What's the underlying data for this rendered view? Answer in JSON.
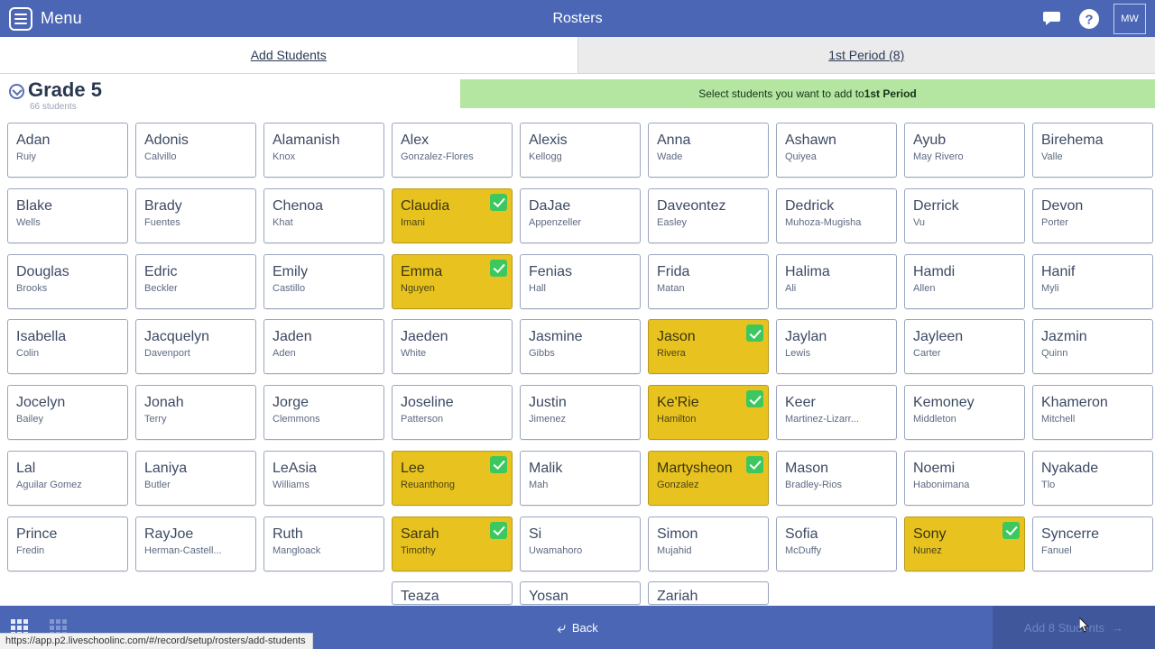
{
  "appbar": {
    "menu_label": "Menu",
    "title": "Rosters",
    "chat_icon": "chat-bubble-icon",
    "help_icon": "question-mark-icon",
    "avatar_initials": "MW"
  },
  "tabs": [
    {
      "label": "Add Students",
      "active": true
    },
    {
      "label": "1st Period (8)",
      "active": false
    }
  ],
  "grade": {
    "name": "Grade 5",
    "count": "66 students",
    "chevron_icon": "chevron-down-circle-icon"
  },
  "banner": {
    "prefix": "Select students you want to add to ",
    "emphasis": "1st Period",
    "color": "#b5e6a1"
  },
  "colors": {
    "brand": "#4a66b5",
    "selected_card": "#e8c320",
    "check_badge": "#3cc85f",
    "banner": "#b5e6a1"
  },
  "students": [
    {
      "first": "Adan",
      "last": "Ruiy",
      "selected": false
    },
    {
      "first": "Adonis",
      "last": "Calvillo",
      "selected": false
    },
    {
      "first": "Alamanish",
      "last": "Knox",
      "selected": false
    },
    {
      "first": "Alex",
      "last": "Gonzalez-Flores",
      "selected": false
    },
    {
      "first": "Alexis",
      "last": "Kellogg",
      "selected": false
    },
    {
      "first": "Anna",
      "last": "Wade",
      "selected": false
    },
    {
      "first": "Ashawn",
      "last": "Quiyea",
      "selected": false
    },
    {
      "first": "Ayub",
      "last": "May Rivero",
      "selected": false
    },
    {
      "first": "Birehema",
      "last": "Valle",
      "selected": false
    },
    {
      "first": "Blake",
      "last": "Wells",
      "selected": false
    },
    {
      "first": "Brady",
      "last": "Fuentes",
      "selected": false
    },
    {
      "first": "Chenoa",
      "last": "Khat",
      "selected": false
    },
    {
      "first": "Claudia",
      "last": "Imani",
      "selected": true
    },
    {
      "first": "DaJae",
      "last": "Appenzeller",
      "selected": false
    },
    {
      "first": "Daveontez",
      "last": "Easley",
      "selected": false
    },
    {
      "first": "Dedrick",
      "last": "Muhoza-Mugisha",
      "selected": false
    },
    {
      "first": "Derrick",
      "last": "Vu",
      "selected": false
    },
    {
      "first": "Devon",
      "last": "Porter",
      "selected": false
    },
    {
      "first": "Douglas",
      "last": "Brooks",
      "selected": false
    },
    {
      "first": "Edric",
      "last": "Beckler",
      "selected": false
    },
    {
      "first": "Emily",
      "last": "Castillo",
      "selected": false
    },
    {
      "first": "Emma",
      "last": "Nguyen",
      "selected": true
    },
    {
      "first": "Fenias",
      "last": "Hall",
      "selected": false
    },
    {
      "first": "Frida",
      "last": "Matan",
      "selected": false
    },
    {
      "first": "Halima",
      "last": "Ali",
      "selected": false
    },
    {
      "first": "Hamdi",
      "last": "Allen",
      "selected": false
    },
    {
      "first": "Hanif",
      "last": "Myli",
      "selected": false
    },
    {
      "first": "Isabella",
      "last": "Colin",
      "selected": false
    },
    {
      "first": "Jacquelyn",
      "last": "Davenport",
      "selected": false
    },
    {
      "first": "Jaden",
      "last": "Aden",
      "selected": false
    },
    {
      "first": "Jaeden",
      "last": "White",
      "selected": false
    },
    {
      "first": "Jasmine",
      "last": "Gibbs",
      "selected": false
    },
    {
      "first": "Jason",
      "last": "Rivera",
      "selected": true
    },
    {
      "first": "Jaylan",
      "last": "Lewis",
      "selected": false
    },
    {
      "first": "Jayleen",
      "last": "Carter",
      "selected": false
    },
    {
      "first": "Jazmin",
      "last": "Quinn",
      "selected": false
    },
    {
      "first": "Jocelyn",
      "last": "Bailey",
      "selected": false
    },
    {
      "first": "Jonah",
      "last": "Terry",
      "selected": false
    },
    {
      "first": "Jorge",
      "last": "Clemmons",
      "selected": false
    },
    {
      "first": "Joseline",
      "last": "Patterson",
      "selected": false
    },
    {
      "first": "Justin",
      "last": "Jimenez",
      "selected": false
    },
    {
      "first": "Ke'Rie",
      "last": "Hamilton",
      "selected": true
    },
    {
      "first": "Keer",
      "last": "Martinez-Lizarr...",
      "selected": false
    },
    {
      "first": "Kemoney",
      "last": "Middleton",
      "selected": false
    },
    {
      "first": "Khameron",
      "last": "Mitchell",
      "selected": false
    },
    {
      "first": "Lal",
      "last": "Aguilar Gomez",
      "selected": false
    },
    {
      "first": "Laniya",
      "last": "Butler",
      "selected": false
    },
    {
      "first": "LeAsia",
      "last": "Williams",
      "selected": false
    },
    {
      "first": "Lee",
      "last": "Reuanthong",
      "selected": true
    },
    {
      "first": "Malik",
      "last": "Mah",
      "selected": false
    },
    {
      "first": "Martysheon",
      "last": "Gonzalez",
      "selected": true
    },
    {
      "first": "Mason",
      "last": "Bradley-Rios",
      "selected": false
    },
    {
      "first": "Noemi",
      "last": "Habonimana",
      "selected": false
    },
    {
      "first": "Nyakade",
      "last": "Tlo",
      "selected": false
    },
    {
      "first": "Prince",
      "last": "Fredin",
      "selected": false
    },
    {
      "first": "RayJoe",
      "last": "Herman-Castell...",
      "selected": false
    },
    {
      "first": "Ruth",
      "last": "Mangloack",
      "selected": false
    },
    {
      "first": "Sarah",
      "last": "Timothy",
      "selected": true
    },
    {
      "first": "Si",
      "last": "Uwamahoro",
      "selected": false
    },
    {
      "first": "Simon",
      "last": "Mujahid",
      "selected": false
    },
    {
      "first": "Sofia",
      "last": "McDuffy",
      "selected": false
    },
    {
      "first": "Sony",
      "last": "Nunez",
      "selected": true
    },
    {
      "first": "Syncerre",
      "last": "Fanuel",
      "selected": false
    }
  ],
  "partial_row": [
    {
      "first": "Teaza",
      "col": 4
    },
    {
      "first": "Yosan",
      "col": 5
    },
    {
      "first": "Zariah",
      "col": 6
    }
  ],
  "bottombar": {
    "back_label": "Back",
    "back_icon": "back-arrow-icon",
    "grid_icon_1": "grid-apps-icon",
    "grid_icon_2": "grid-table-icon",
    "add_label": "Add 8 Students",
    "add_arrow_icon": "arrow-right-icon"
  },
  "statusbar": {
    "url": "https://app.p2.liveschoolinc.com/#/record/setup/rosters/add-students"
  }
}
